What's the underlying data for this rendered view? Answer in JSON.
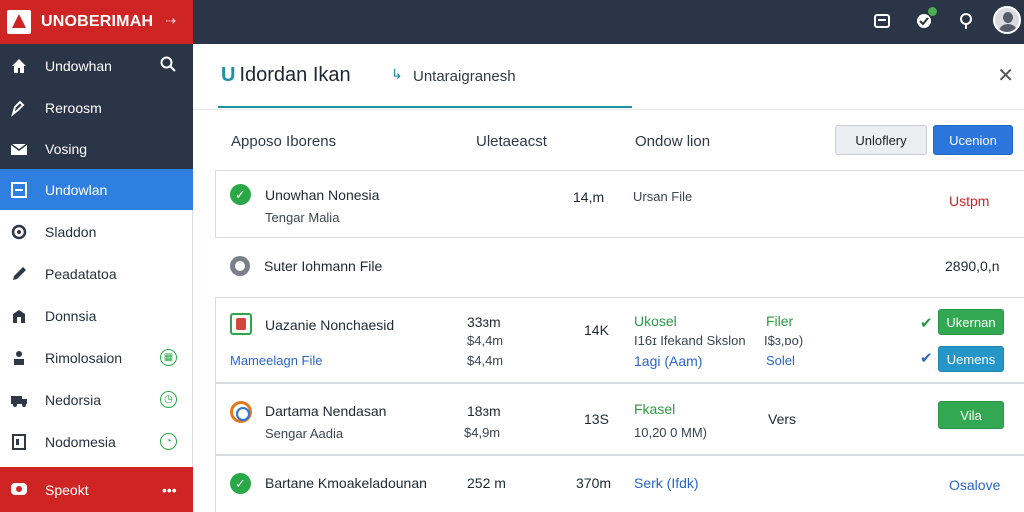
{
  "brand": {
    "name": "UNOBERIMAH"
  },
  "nav": [
    {
      "label": "Undowhan"
    },
    {
      "label": "Reroosm"
    },
    {
      "label": "Vosing"
    },
    {
      "label": "Undowlan"
    },
    {
      "label": "Sladdon"
    },
    {
      "label": "Peadatatoa"
    },
    {
      "label": "Donnsia"
    },
    {
      "label": "Rimolosaion"
    },
    {
      "label": "Nedorsia"
    },
    {
      "label": "Nodomesia"
    },
    {
      "label": "Speokt"
    }
  ],
  "panel": {
    "title_prefix": "U",
    "title": "Idordan Ikan",
    "subtitle": "Untaraigranesh"
  },
  "toolbar": {
    "col1": "Apposo Iborens",
    "col2": "Uletaeacst",
    "col3": "Ondow lion",
    "btn_secondary": "Unloflery",
    "btn_primary": "Ucenion"
  },
  "rows": [
    {
      "title": "Unowhan Nonesia",
      "sub": "Tengar Malia",
      "size": "14,m",
      "type": "Ursan File",
      "action": "Ustpm"
    },
    {
      "title": "Suter Iohmann File",
      "size": "2890,0,n"
    },
    {
      "title": "Uazanie Nonchaesid",
      "sub": "Mameelagn File",
      "size_a": "33ɜm",
      "size_b": "$4,4m",
      "size_c": "$4,4m",
      "count": "14K",
      "type_a": "Ukosel",
      "type_b": "I16ɪ Ifekand Skslon",
      "type_c": "1agi (Aam)",
      "ext_a": "Filer",
      "ext_b": "I$ɜ,ɒo)",
      "ext_c": "Solel",
      "btn_a": "Ukernan",
      "btn_b": "Uemens"
    },
    {
      "title": "Dartama Nendasan",
      "sub": "Sengar Aadia",
      "size_a": "18ɜm",
      "size_b": "$4,9m",
      "count": "13S",
      "type_a": "Fkasel",
      "type_b": "10,20 0 MM)",
      "ext": "Vers",
      "btn": "Vila"
    },
    {
      "title": "Bartane Kmoakeladounan",
      "size": "252 m",
      "count": "370m",
      "type": "Serk (Ifdk)",
      "action": "Osalove"
    }
  ],
  "colors": {
    "topbar": "#2a3547",
    "brand_red": "#cf2424",
    "accent_blue": "#2f7fe0",
    "teal": "#1e8fa5",
    "success_green": "#2aa847"
  }
}
